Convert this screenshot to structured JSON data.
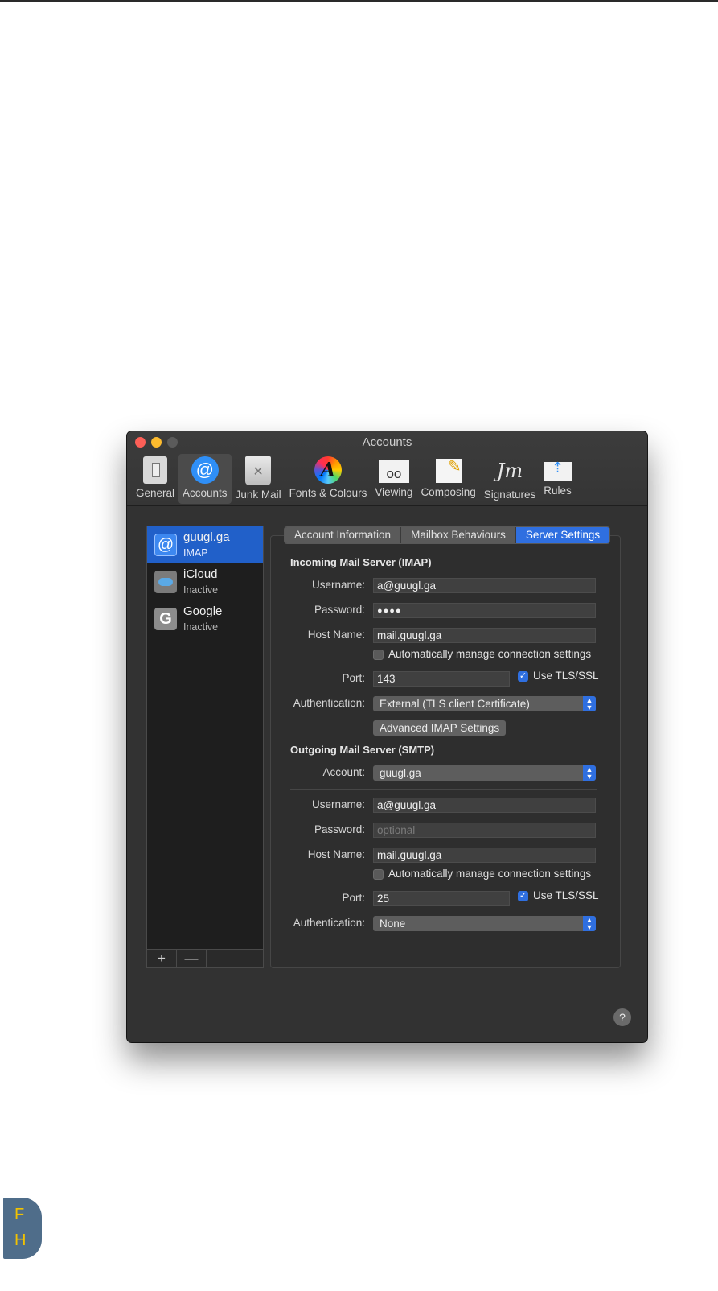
{
  "window": {
    "title": "Accounts",
    "toolbar": [
      {
        "label": "General",
        "icon": "general-switch-icon"
      },
      {
        "label": "Accounts",
        "icon": "at-sign-icon",
        "icon_glyph": "@",
        "active": true
      },
      {
        "label": "Junk Mail",
        "icon": "trash-bin-icon",
        "icon_glyph": "✕"
      },
      {
        "label": "Fonts & Colours",
        "icon": "color-wheel-icon",
        "icon_glyph": "A"
      },
      {
        "label": "Viewing",
        "icon": "glasses-icon",
        "icon_glyph": "oo"
      },
      {
        "label": "Composing",
        "icon": "pencil-paper-icon",
        "icon_glyph": "✎"
      },
      {
        "label": "Signatures",
        "icon": "signature-icon",
        "icon_glyph": "Jm"
      },
      {
        "label": "Rules",
        "icon": "envelope-arrows-icon",
        "icon_glyph": "⇡"
      }
    ]
  },
  "accounts": [
    {
      "name": "guugl.ga",
      "type": "IMAP",
      "icon": "at-sign-icon",
      "icon_glyph": "@",
      "selected": true
    },
    {
      "name": "iCloud",
      "type": "Inactive",
      "icon": "icloud-icon"
    },
    {
      "name": "Google",
      "type": "Inactive",
      "icon": "google-icon",
      "icon_glyph": "G"
    }
  ],
  "list_buttons": {
    "add": "+",
    "remove": "—"
  },
  "tabs": [
    {
      "label": "Account Information"
    },
    {
      "label": "Mailbox Behaviours"
    },
    {
      "label": "Server Settings",
      "active": true
    }
  ],
  "incoming": {
    "heading": "Incoming Mail Server (IMAP)",
    "username_label": "Username:",
    "username": "a@guugl.ga",
    "password_label": "Password:",
    "password": "●●●●",
    "host_label": "Host Name:",
    "host": "mail.guugl.ga",
    "auto_manage_label": "Automatically manage connection settings",
    "auto_manage": false,
    "port_label": "Port:",
    "port": "143",
    "tls_label": "Use TLS/SSL",
    "tls": true,
    "auth_label": "Authentication:",
    "auth": "External (TLS client Certificate)",
    "advanced_button": "Advanced IMAP Settings"
  },
  "outgoing": {
    "heading": "Outgoing Mail Server (SMTP)",
    "account_label": "Account:",
    "account": "guugl.ga",
    "username_label": "Username:",
    "username": "a@guugl.ga",
    "password_label": "Password:",
    "password_placeholder": "optional",
    "host_label": "Host Name:",
    "host": "mail.guugl.ga",
    "auto_manage_label": "Automatically manage connection settings",
    "auto_manage": false,
    "port_label": "Port:",
    "port": "25",
    "tls_label": "Use TLS/SSL",
    "tls": true,
    "auth_label": "Authentication:",
    "auth": "None"
  },
  "help": "?",
  "logo": {
    "letter_top": "F",
    "letter_bottom": "H"
  },
  "colors": {
    "accent": "#2f6fe0",
    "selection": "#2160c9",
    "window_bg": "#323232"
  }
}
